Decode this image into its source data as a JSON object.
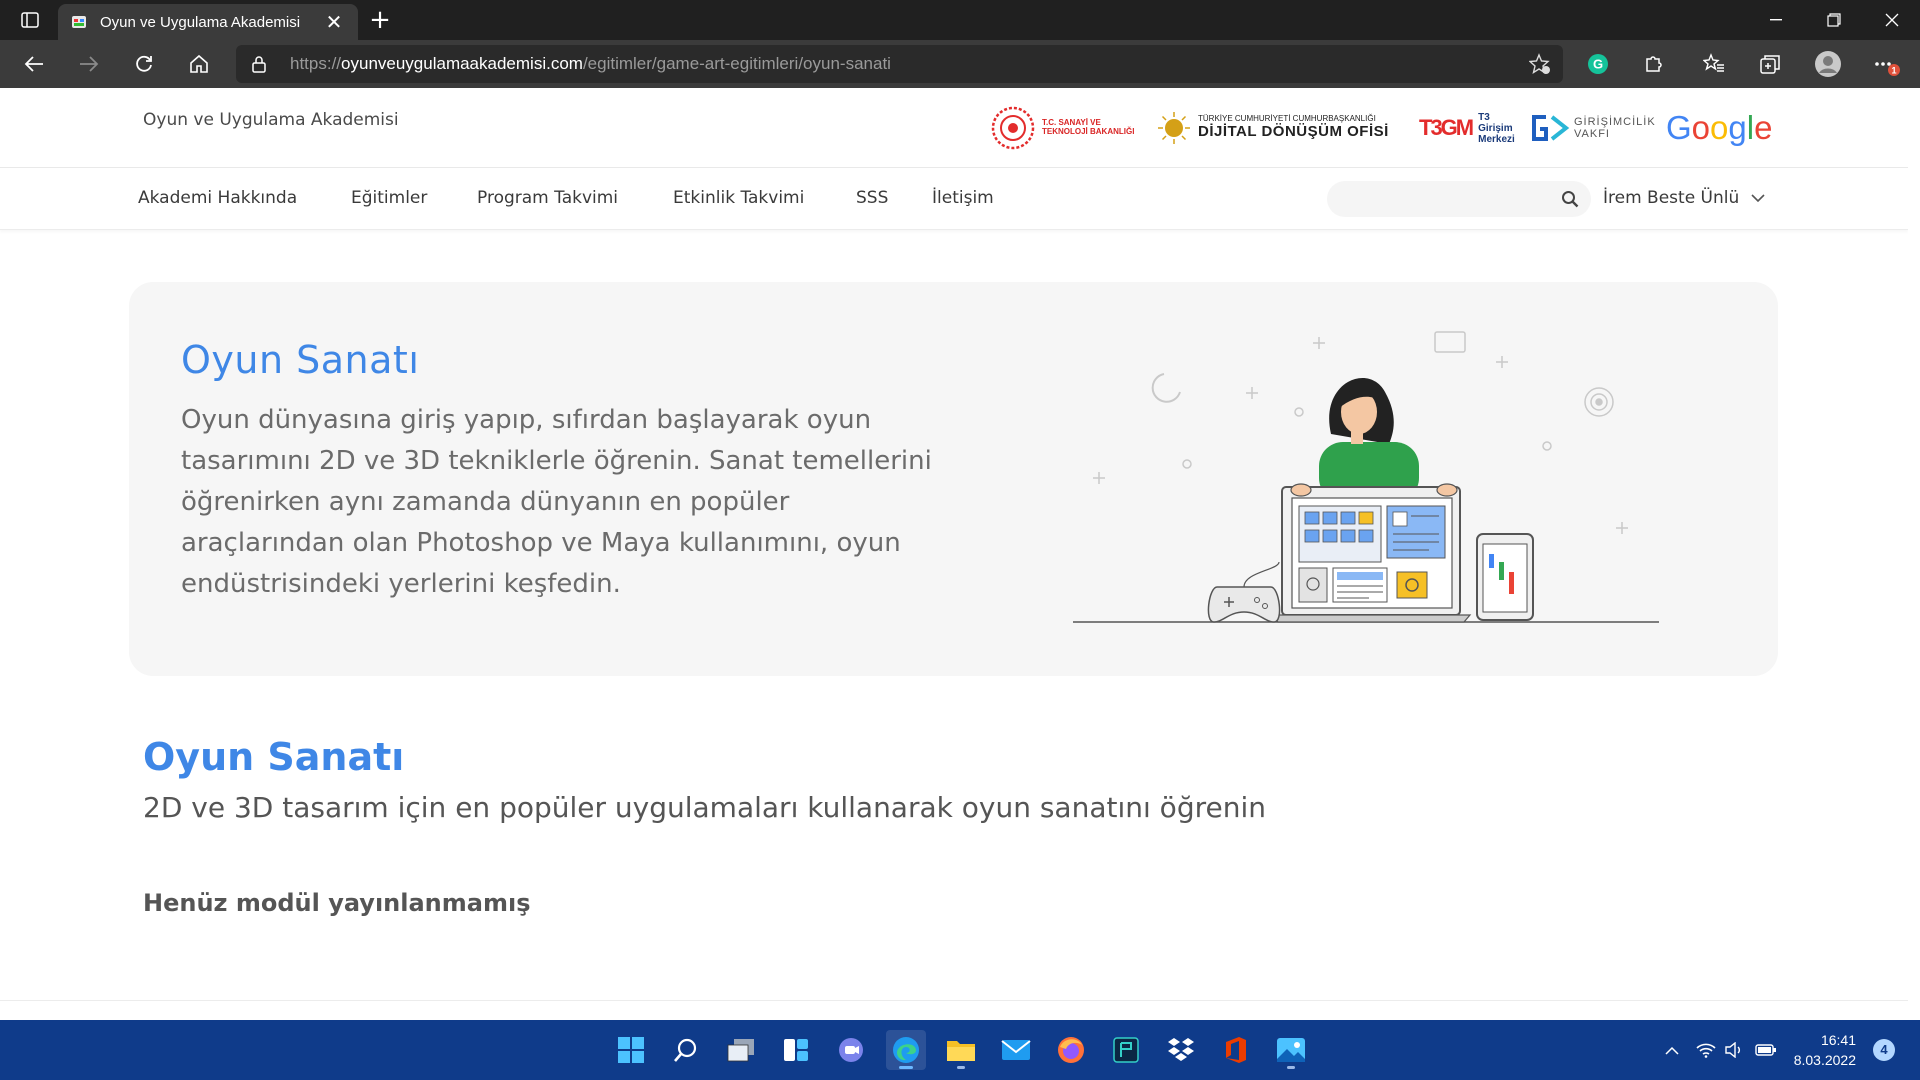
{
  "browser": {
    "tab_title": "Oyun ve Uygulama Akademisi",
    "tab_close": "✕",
    "new_tab": "+",
    "url_scheme": "https://",
    "url_domain": "oyunveuygulamaakademisi.com",
    "url_path": "/egitimler/game-art-egitimleri/oyun-sanati",
    "profile_notification": "1"
  },
  "site": {
    "title": "Oyun ve Uygulama Akademisi",
    "partners": {
      "ministry": [
        "T.C. SANAYİ VE",
        "TEKNOLOJİ BAKANLIĞI"
      ],
      "ddo_line1": "TÜRKİYE CUMHURİYETİ CUMHURBAŞKANLIĞI",
      "ddo_line2": "DİJİTAL DÖNÜŞÜM OFİSİ",
      "t3_mark": "T3GM",
      "t3_text": [
        "T3",
        "Girişim",
        "Merkezi"
      ],
      "gv_text": [
        "GİRİŞİMCİLİK",
        "VAKFI"
      ],
      "google": [
        "G",
        "o",
        "o",
        "g",
        "l",
        "e"
      ]
    },
    "nav": [
      "Akademi Hakkında",
      "Eğitimler",
      "Program Takvimi",
      "Etkinlik Takvimi",
      "SSS",
      "İletişim"
    ],
    "search_placeholder": "",
    "user_name": "İrem Beste Ünlü"
  },
  "hero": {
    "title": "Oyun Sanatı",
    "description": "Oyun dünyasına giriş yapıp, sıfırdan başlayarak oyun tasarımını 2D ve 3D tekniklerle öğrenin. Sanat temellerini öğrenirken aynı zamanda dünyanın en popüler araçlarından olan Photoshop ve Maya kullanımını, oyun endüstrisindeki yerlerini keşfedin."
  },
  "course": {
    "title": "Oyun Sanatı",
    "subtitle": "2D ve 3D tasarım için en popüler uygulamaları kullanarak oyun sanatını öğrenin",
    "empty_message": "Henüz modül yayınlanmamış"
  },
  "taskbar": {
    "apps": [
      "start-icon",
      "search-icon",
      "task-view-icon",
      "widgets-icon",
      "teams-chat-icon",
      "edge-icon",
      "file-explorer-icon",
      "mail-icon",
      "firefox-icon",
      "terminal-app-icon",
      "dropbox-icon",
      "office-icon",
      "photos-icon"
    ],
    "time": "16:41",
    "date": "8.03.2022",
    "notifications": "4"
  },
  "colors": {
    "accent": "#3f87e6",
    "taskbar": "#0f3b8a",
    "chrome_dark": "#202020",
    "chrome_toolbar": "#3b3b3b"
  }
}
